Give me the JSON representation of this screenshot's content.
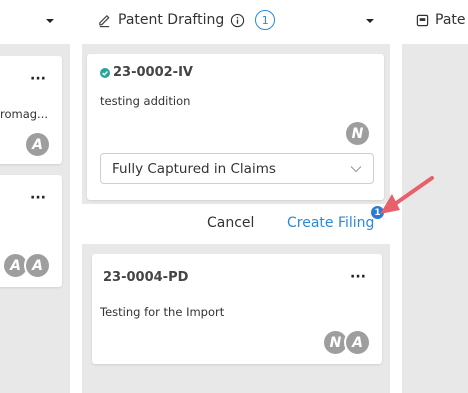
{
  "columns": [
    {
      "cards": [
        {
          "desc": "romag...",
          "menu": "···",
          "avatars": [
            "A"
          ]
        },
        {
          "menu": "···",
          "avatars": [
            "A",
            "A"
          ]
        }
      ]
    },
    {
      "title": "Patent Drafting",
      "count": "1",
      "cards": [
        {
          "id": "23-0002-IV",
          "desc": "testing addition",
          "menu": "···",
          "avatars": [
            "N"
          ],
          "select_value": "Fully Captured in Claims"
        },
        {
          "id": "23-0004-PD",
          "desc": "Testing for the Import",
          "menu": "···",
          "avatars": [
            "N",
            "A"
          ]
        }
      ],
      "actions": {
        "cancel": "Cancel",
        "create": "Create Filing",
        "badge": "1"
      }
    },
    {
      "title": "Pate"
    }
  ],
  "colors": {
    "column_bg": "#e8e8e8",
    "accent": "#2b8ad8",
    "arrow": "#e8606a",
    "check": "#26a69a",
    "avatar": "#9e9e9e"
  }
}
